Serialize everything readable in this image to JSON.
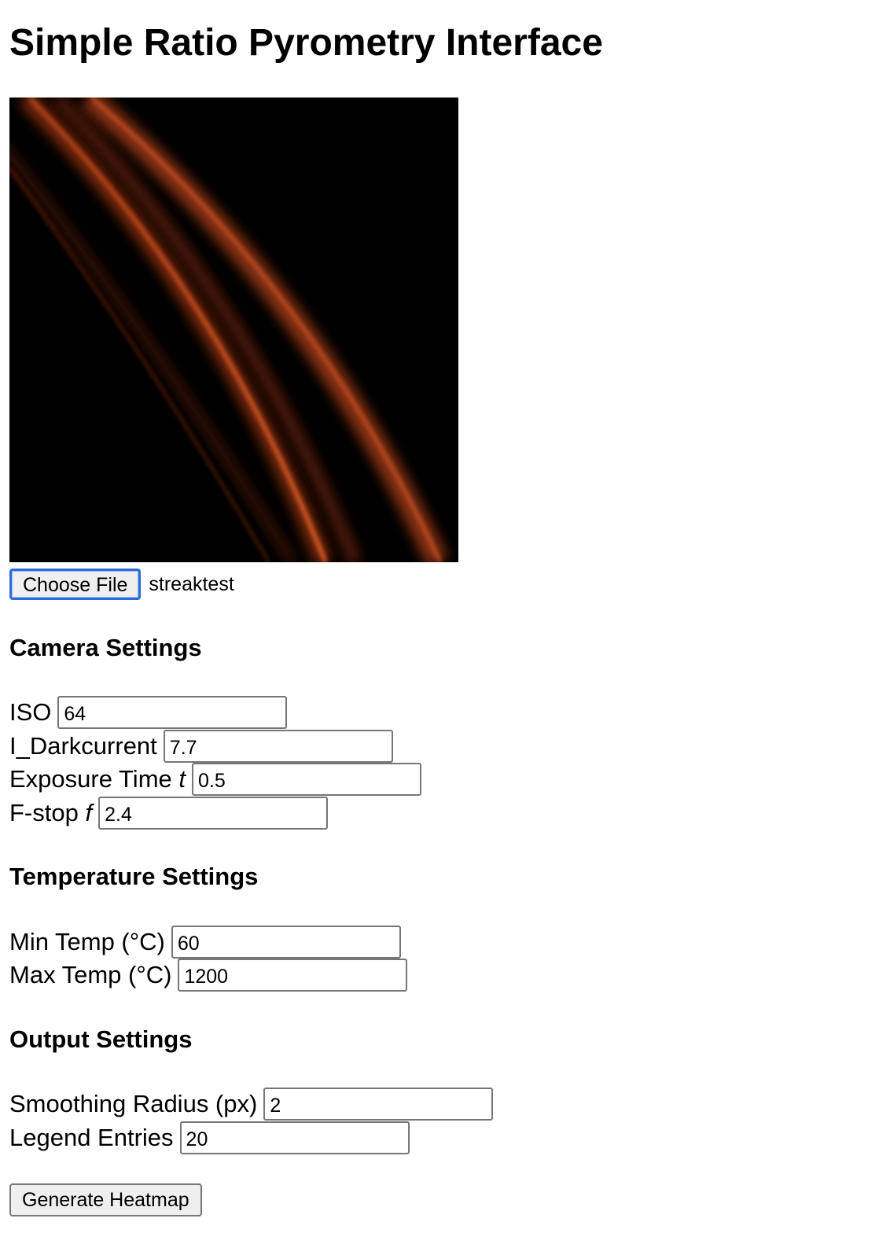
{
  "page": {
    "title": "Simple Ratio Pyrometry Interface"
  },
  "file_input": {
    "button_label": "Choose File",
    "file_name": "streaktest"
  },
  "camera_settings": {
    "heading": "Camera Settings",
    "iso": {
      "label": "ISO",
      "value": "64"
    },
    "darkcurrent": {
      "label": "I_Darkcurrent",
      "value": "7.7"
    },
    "exposure": {
      "label": "Exposure Time ",
      "var": "t",
      "value": "0.5"
    },
    "fstop": {
      "label": "F-stop ",
      "var": "f",
      "value": "2.4"
    }
  },
  "temperature_settings": {
    "heading": "Temperature Settings",
    "min_temp": {
      "label": "Min Temp (°C)",
      "value": "60"
    },
    "max_temp": {
      "label": "Max Temp (°C)",
      "value": "1200"
    }
  },
  "output_settings": {
    "heading": "Output Settings",
    "smoothing": {
      "label": "Smoothing Radius (px)",
      "value": "2"
    },
    "legend": {
      "label": "Legend Entries",
      "value": "20"
    }
  },
  "actions": {
    "generate_label": "Generate Heatmap"
  },
  "colors": {
    "streak_bright": "#e8642a",
    "streak_dark": "#8a2e10",
    "focus_ring": "#2f6bd8"
  }
}
